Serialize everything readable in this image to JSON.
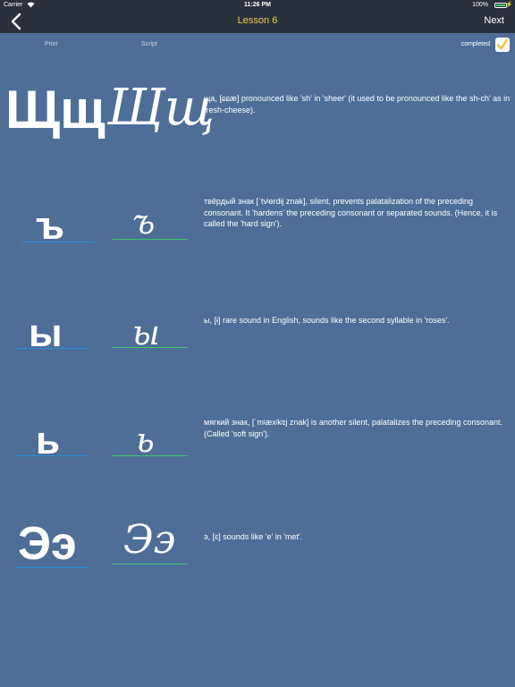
{
  "status_bar": {
    "carrier": "Carrier",
    "wifi_icon": "wifi-icon",
    "time": "11:26 PM",
    "battery_pct": "100%"
  },
  "nav": {
    "back_icon": "chevron-left-icon",
    "title": "Lesson 6",
    "next_label": "Next"
  },
  "columns": {
    "print_label": "Print",
    "script_label": "Script",
    "completed_label": "completed"
  },
  "colors": {
    "background": "#4e6e98",
    "nav_background": "#29313d",
    "title_accent": "#f2c94c",
    "checkmark": "#f2c230",
    "print_baseline": "#2b8fd8",
    "script_baseline": "#3ec46d"
  },
  "letters": [
    {
      "print": "Щщ",
      "script": "Щщ",
      "description": "ща, [ɕɕæ] pronounced like 'sh' in 'sheer' (it used to be pronounced like the  sh-ch' as in fresh-cheese)."
    },
    {
      "print": "ъ",
      "script": "ъ",
      "description": "твёрдый знак [ˈtvʲɵrdɨj znak], silent, prevents palatalization of the preceding consonant. It 'hardens' the preceding consonant or separated sounds. (Hence, it is called the 'hard sign')."
    },
    {
      "print": "ы",
      "script": "ы",
      "description": "ы, [ɨ] rare sound in English, sounds like the second syllable in 'roses'."
    },
    {
      "print": "ь",
      "script": "ь",
      "description": "мягкий знак, [ˈmʲæxʲkʲɪj znak] is another silent, palatalizes the preceding consonant. (Called 'soft sign')."
    },
    {
      "print": "Ээ",
      "script": "Ээ",
      "description": "э, [ɛ] sounds like 'e' in 'met'."
    }
  ]
}
